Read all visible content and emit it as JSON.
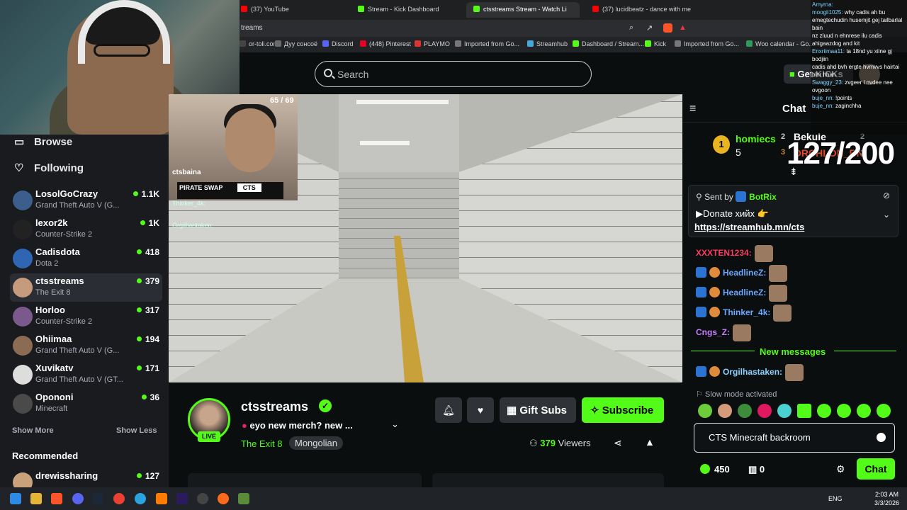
{
  "browser": {
    "tabs": [
      {
        "label": "(37) YouTube",
        "color": "#ff0000"
      },
      {
        "label": "Stream - Kick Dashboard",
        "color": "#53fc18"
      },
      {
        "label": "ctsstreams Stream - Watch Li",
        "color": "#53fc18",
        "active": true
      },
      {
        "label": "(37) lucidbeatz - dance with me",
        "color": "#ff0000"
      }
    ],
    "url": "treams",
    "bookmarks": [
      "or-toli.com",
      "Дуу сонсоё",
      "Discord",
      "(448) Pinterest",
      "PLAYMO",
      "Imported from Go...",
      "Streamhub",
      "Dashboard / Stream...",
      "Kick",
      "Imported from Go...",
      "Woo calendar - Go..."
    ]
  },
  "header": {
    "search_placeholder": "Search",
    "get_kicks": "Get KICKs"
  },
  "sidebar": {
    "browse": "Browse",
    "following": "Following",
    "channels": [
      {
        "name": "LosolGoCrazy",
        "game": "Grand Theft Auto V (G...",
        "viewers": "1.1K",
        "avatar_color": "#3b5e8c"
      },
      {
        "name": "lexor2k",
        "game": "Counter-Strike 2",
        "viewers": "1K",
        "avatar_color": "#222222"
      },
      {
        "name": "Cadisdota",
        "game": "Dota 2",
        "viewers": "418",
        "avatar_color": "#2f66b3"
      },
      {
        "name": "ctsstreams",
        "game": "The Exit 8",
        "viewers": "379",
        "avatar_color": "#c69a7c",
        "active": true
      },
      {
        "name": "Horloo",
        "game": "Counter-Strike 2",
        "viewers": "317",
        "avatar_color": "#7a5a8c"
      },
      {
        "name": "Ohiimaa",
        "game": "Grand Theft Auto V (G...",
        "viewers": "194",
        "avatar_color": "#8a6c55"
      },
      {
        "name": "Xuvikatv",
        "game": "Grand Theft Auto V (GT...",
        "viewers": "171",
        "avatar_color": "#dddddd"
      },
      {
        "name": "Opononi",
        "game": "Minecraft",
        "viewers": "36",
        "avatar_color": "#4a4a4a"
      }
    ],
    "show_more": "Show More",
    "show_less": "Show Less",
    "recommended": "Recommended",
    "recommended_channels": [
      {
        "name": "drewissharing",
        "viewers": "127",
        "avatar_color": "#c9a27c"
      }
    ]
  },
  "player": {
    "counter": "65 / 69",
    "overlay_streamer": "ctsbaina",
    "overlay_sponsor": "PIRATE SWAP",
    "overlay_promo": "CTS",
    "overlay_chat": [
      "Thinker_4k:",
      "Orgilhastaken:"
    ]
  },
  "stream": {
    "name": "ctsstreams",
    "live": "LIVE",
    "title": "eyo new merch? new ...",
    "category": "The Exit 8",
    "language": "Mongolian",
    "gift_subs": "Gift Subs",
    "subscribe": "Subscribe",
    "viewers_count": "379",
    "viewers_label": "Viewers"
  },
  "chat": {
    "title": "Chat",
    "leaderboard": [
      {
        "rank": "1",
        "name": "homiecs",
        "amount": "5"
      },
      {
        "rank": "2",
        "name": "Bekule",
        "amount": "2"
      },
      {
        "rank": "3",
        "name": "ORCHLON_BN",
        "amount": "2"
      }
    ],
    "overlay_counter": "127/200",
    "pinned": {
      "sent_by_label": "Sent by",
      "sender": "BotRix",
      "line1": "▶Donate хийх 👉",
      "link": "https://streamhub.mn/cts"
    },
    "messages": [
      {
        "user": "XXXTEN1234:",
        "color": "#ff3b5c"
      },
      {
        "user": "HeadlineZ:",
        "color": "#6aa8ff"
      },
      {
        "user": "HeadlineZ:",
        "color": "#6aa8ff"
      },
      {
        "user": "Thinker_4k:",
        "color": "#6aa8ff"
      },
      {
        "user": "Cngs_Z:",
        "color": "#c77dff"
      }
    ],
    "new_messages": "New messages",
    "after_new": [
      {
        "user": "Orgilhastaken:",
        "color": "#8ad1ff"
      }
    ],
    "slow_mode": "Slow mode activated",
    "input_value": "CTS Minecraft backroom",
    "points": "450",
    "drops": "0",
    "send": "Chat"
  },
  "overlay_chat_right": [
    {
      "user": "Amyrna:",
      "text": ""
    },
    {
      "user": "moogii1025:",
      "text": "why cadis ah bu emegtechudin husemjit gej tailbarlal bain"
    },
    {
      "user": "",
      "text": "nz zluud n ehnrese ilu cadis ahigaazdog and kit"
    },
    {
      "user": "Enxriimaa11:",
      "text": "ta 18nd yu xiine gj bodjiin"
    },
    {
      "user": "",
      "text": "cadis ahd bvh ergte hvmvvs hairtai blhr hhah"
    },
    {
      "user": "Swaggy_23:",
      "text": "zvgeer l nvdee nee ovgoon"
    },
    {
      "user": "buje_nn:",
      "text": "!points"
    },
    {
      "user": "buje_nn:",
      "text": "zaginchha"
    }
  ],
  "taskbar": {
    "lang": "ENG",
    "time": "2:03 AM",
    "date": "3/3/2026"
  }
}
